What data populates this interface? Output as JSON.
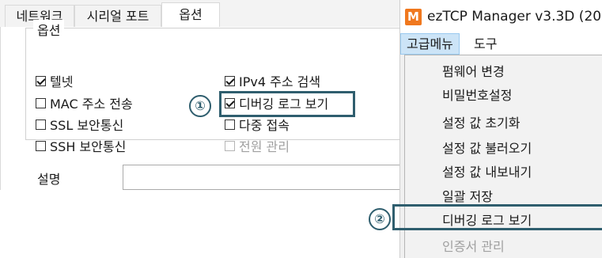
{
  "left_panel": {
    "tabs": [
      {
        "label": "네트워크"
      },
      {
        "label": "시리얼 포트"
      },
      {
        "label": "옵션"
      }
    ],
    "group_title": "옵션",
    "options_left": [
      {
        "label": "텔넷",
        "checked": true
      },
      {
        "label": "MAC 주소 전송",
        "checked": false
      },
      {
        "label": "SSL 보안통신",
        "checked": false
      },
      {
        "label": "SSH 보안통신",
        "checked": false
      }
    ],
    "options_right": [
      {
        "label": "IPv4 주소 검색",
        "checked": true
      },
      {
        "label": "디버깅 로그 보기",
        "checked": true
      },
      {
        "label": "다중 접속",
        "checked": false
      },
      {
        "label": "전원 관리",
        "checked": false,
        "disabled": true
      }
    ],
    "description_label": "설명",
    "description_value": ""
  },
  "annotations": {
    "badge1": "①",
    "badge2": "②",
    "color": "#2f5e6e"
  },
  "app_window": {
    "icon_letter": "M",
    "icon_color": "#f0781e",
    "title": "ezTCP Manager v3.3D (2018/",
    "menu": {
      "advanced": "고급메뉴",
      "tools": "도구"
    },
    "dropdown_items": [
      {
        "label": "펌웨어 변경"
      },
      {
        "label": "비밀번호설정"
      },
      {
        "label": "설정 값 초기화"
      },
      {
        "label": "설정 값 불러오기"
      },
      {
        "label": "설정 값 내보내기"
      },
      {
        "label": "일괄 저장"
      },
      {
        "label": "디버깅 로그 보기"
      },
      {
        "label": "인증서 관리",
        "disabled": true
      }
    ]
  }
}
